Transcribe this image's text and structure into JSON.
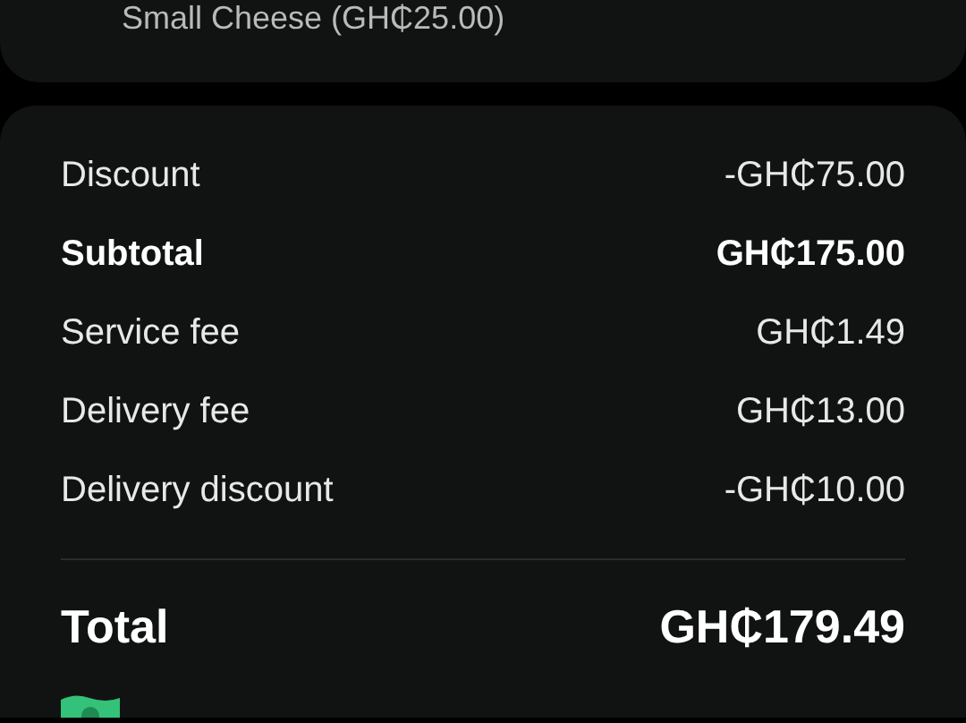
{
  "item_card": {
    "option": "Small Cheese (GH₵25.00)"
  },
  "summary": {
    "rows": [
      {
        "label": "Discount",
        "value": "-GH₵75.00",
        "kind": "normal"
      },
      {
        "label": "Subtotal",
        "value": "GH₵175.00",
        "kind": "bold"
      },
      {
        "label": "Service fee",
        "value": "GH₵1.49",
        "kind": "normal"
      },
      {
        "label": "Delivery fee",
        "value": "GH₵13.00",
        "kind": "normal"
      },
      {
        "label": "Delivery discount",
        "value": "-GH₵10.00",
        "kind": "normal"
      }
    ],
    "total": {
      "label": "Total",
      "value": "GH₵179.49"
    }
  }
}
